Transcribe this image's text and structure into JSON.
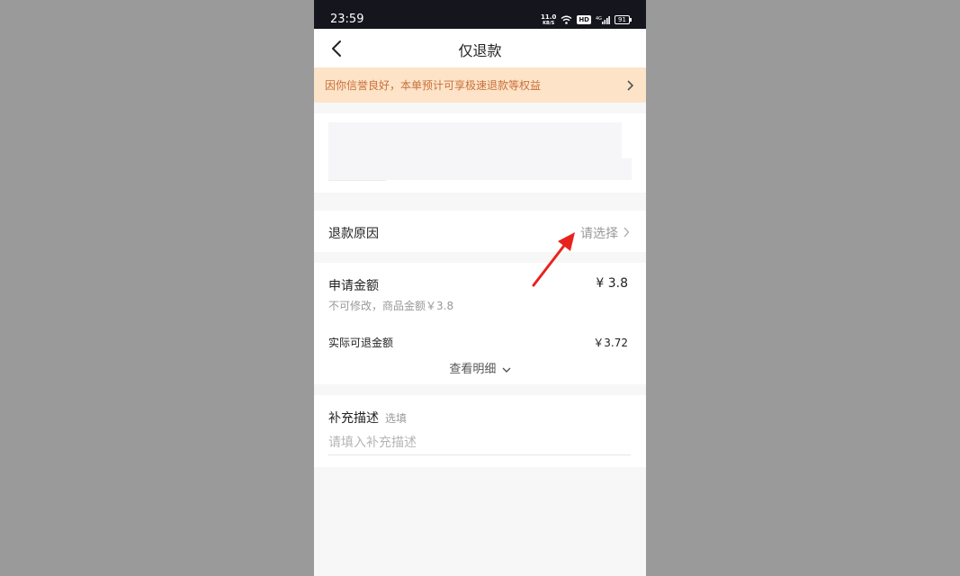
{
  "status_bar": {
    "time": "23:59",
    "net_speed_value": "11.0",
    "net_speed_unit": "KB/S",
    "signal_label": "4G",
    "hd_label": "HD",
    "battery": "91"
  },
  "header": {
    "title": "仅退款",
    "back_icon": "chevron-left-icon"
  },
  "banner": {
    "text": "因你信誉良好，本单预计可享极速退款等权益",
    "icon": "chevron-right-icon"
  },
  "refund_reason": {
    "label": "退款原因",
    "value": "请选择",
    "icon": "chevron-right-icon"
  },
  "amount": {
    "label": "申请金额",
    "value": "¥ 3.8",
    "note": "不可修改，商品金额￥3.8",
    "actual_label": "实际可退金额",
    "actual_value": "￥3.72",
    "detail_toggle": "查看明细"
  },
  "description": {
    "label": "补充描述",
    "optional": "选填",
    "placeholder": "请填入补充描述",
    "value": ""
  },
  "colors": {
    "banner_bg": "#fde3c8",
    "banner_text": "#c8703a",
    "annotation_arrow": "#e8231e"
  }
}
